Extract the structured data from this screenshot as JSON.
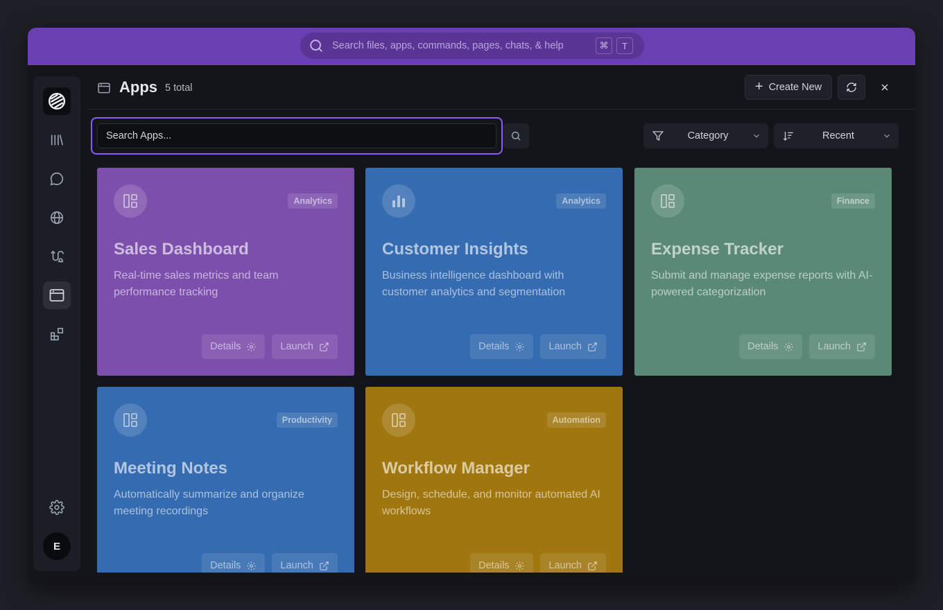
{
  "topbar": {
    "search_placeholder": "Search files, apps, commands, pages, chats, & help",
    "shortcut_keys": [
      "⌘",
      "T"
    ]
  },
  "sidebar": {
    "items": [
      {
        "name": "logo",
        "icon": "stack-logo-icon"
      },
      {
        "name": "library",
        "icon": "library-icon"
      },
      {
        "name": "chat",
        "icon": "chat-bubble-icon"
      },
      {
        "name": "web",
        "icon": "globe-icon"
      },
      {
        "name": "workflows",
        "icon": "route-icon"
      },
      {
        "name": "apps",
        "icon": "app-window-icon",
        "active": true
      },
      {
        "name": "integrations",
        "icon": "blocks-icon"
      },
      {
        "name": "settings",
        "icon": "gear-icon"
      }
    ],
    "avatar_initial": "E"
  },
  "header": {
    "title": "Apps",
    "count": "5 total",
    "create_label": "Create New"
  },
  "search": {
    "placeholder": "Search Apps..."
  },
  "filters": {
    "category_label": "Category",
    "sort_label": "Recent"
  },
  "cards": [
    {
      "title": "Sales Dashboard",
      "badge": "Analytics",
      "description": "Real-time sales metrics and team performance tracking",
      "color": "#7d4fad",
      "icon": "layout-dashboard-icon",
      "details_label": "Details",
      "launch_label": "Launch"
    },
    {
      "title": "Customer Insights",
      "badge": "Analytics",
      "description": "Business intelligence dashboard with customer analytics and segmentation",
      "color": "#356bb0",
      "icon": "bar-chart-icon",
      "details_label": "Details",
      "launch_label": "Launch"
    },
    {
      "title": "Expense Tracker",
      "badge": "Finance",
      "description": "Submit and manage expense reports with AI-powered categorization",
      "color": "#5a8a76",
      "icon": "layout-dashboard-icon",
      "details_label": "Details",
      "launch_label": "Launch"
    },
    {
      "title": "Meeting Notes",
      "badge": "Productivity",
      "description": "Automatically summarize and organize meeting recordings",
      "color": "#356bb0",
      "icon": "layout-dashboard-icon",
      "details_label": "Details",
      "launch_label": "Launch"
    },
    {
      "title": "Workflow Manager",
      "badge": "Automation",
      "description": "Design, schedule, and monitor automated AI workflows",
      "color": "#a0760f",
      "icon": "layout-dashboard-icon",
      "details_label": "Details",
      "launch_label": "Launch"
    }
  ]
}
